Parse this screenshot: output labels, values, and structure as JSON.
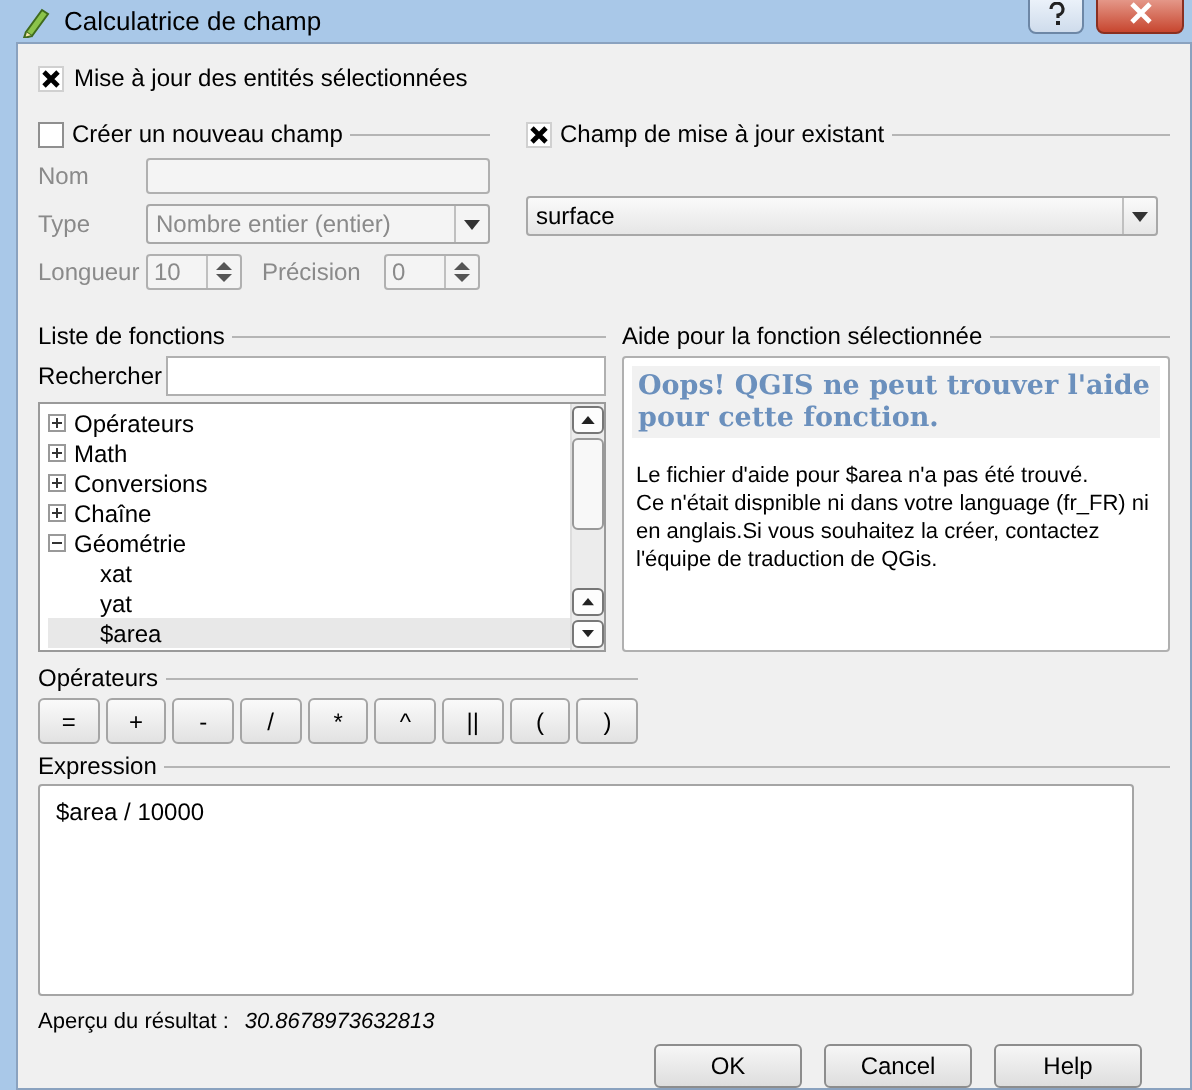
{
  "window": {
    "title": "Calculatrice de champ"
  },
  "update_selected": {
    "label": "Mise à jour des entités sélectionnées",
    "checked": true
  },
  "new_field": {
    "label": "Créer un nouveau champ",
    "checked": false,
    "disabled": true,
    "name_label": "Nom",
    "type_label": "Type",
    "type_value": "Nombre entier (entier)",
    "length_label": "Longueur",
    "length_value": "10",
    "precision_label": "Précision",
    "precision_value": "0"
  },
  "existing_field": {
    "label": "Champ de mise à jour existant",
    "checked": true,
    "value": "surface"
  },
  "function_list": {
    "title": "Liste de fonctions",
    "search_label": "Rechercher",
    "items": [
      {
        "label": "Opérateurs",
        "expanded": false,
        "selected": false
      },
      {
        "label": "Math",
        "expanded": false,
        "selected": false
      },
      {
        "label": "Conversions",
        "expanded": false,
        "selected": false
      },
      {
        "label": "Chaîne",
        "expanded": false,
        "selected": false
      },
      {
        "label": "Géométrie",
        "expanded": true,
        "selected": false,
        "children": [
          {
            "label": "xat",
            "selected": false
          },
          {
            "label": "yat",
            "selected": false
          },
          {
            "label": "$area",
            "selected": true
          }
        ]
      }
    ]
  },
  "help": {
    "title": "Aide pour la fonction sélectionnée",
    "heading": "Oops! QGIS ne peut trouver l'aide pour cette fonction.",
    "paragraphs": [
      "Le fichier d'aide pour $area n'a pas été trouvé.",
      "Ce n'était dispnible ni dans votre language (fr_FR) ni en anglais.Si vous souhaitez la créer, contactez l'équipe de traduction de QGis."
    ]
  },
  "operators": {
    "title": "Opérateurs",
    "buttons": [
      "=",
      "+",
      "-",
      "/",
      "*",
      "^",
      "||",
      "(",
      ")"
    ]
  },
  "expression": {
    "title": "Expression",
    "value": "$area / 10000"
  },
  "preview": {
    "label": "Aperçu du résultat :",
    "value": "30.8678973632813"
  },
  "buttons": [
    "OK",
    "Cancel",
    "Help"
  ]
}
